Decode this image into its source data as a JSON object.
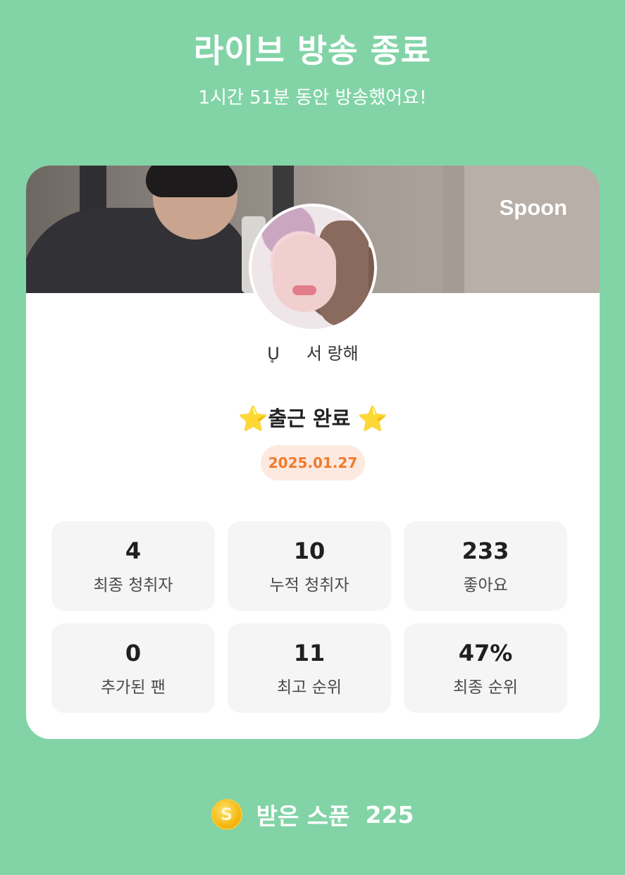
{
  "header": {
    "title": "라이브 방송 종료",
    "subtitle": "1시간 51분 동안 방송했어요!"
  },
  "card": {
    "brand": "Spoon",
    "username_prefix": "U",
    "username": "서 랑해",
    "checkin_label": "출근 완료",
    "star_icon": "⭐",
    "date": "2025.01.27",
    "stats": [
      {
        "value": "4",
        "label": "최종 청취자"
      },
      {
        "value": "10",
        "label": "누적 청취자"
      },
      {
        "value": "233",
        "label": "좋아요"
      },
      {
        "value": "0",
        "label": "추가된 팬"
      },
      {
        "value": "11",
        "label": "최고 순위"
      },
      {
        "value": "47%",
        "label": "최종 순위"
      }
    ]
  },
  "footer": {
    "coin_symbol": "S",
    "spoons_label": "받은 스푼",
    "spoons_value": "225"
  },
  "colors": {
    "background": "#82d4a7",
    "date_accent": "#f27a2c",
    "date_badge_bg": "#fde9df"
  }
}
